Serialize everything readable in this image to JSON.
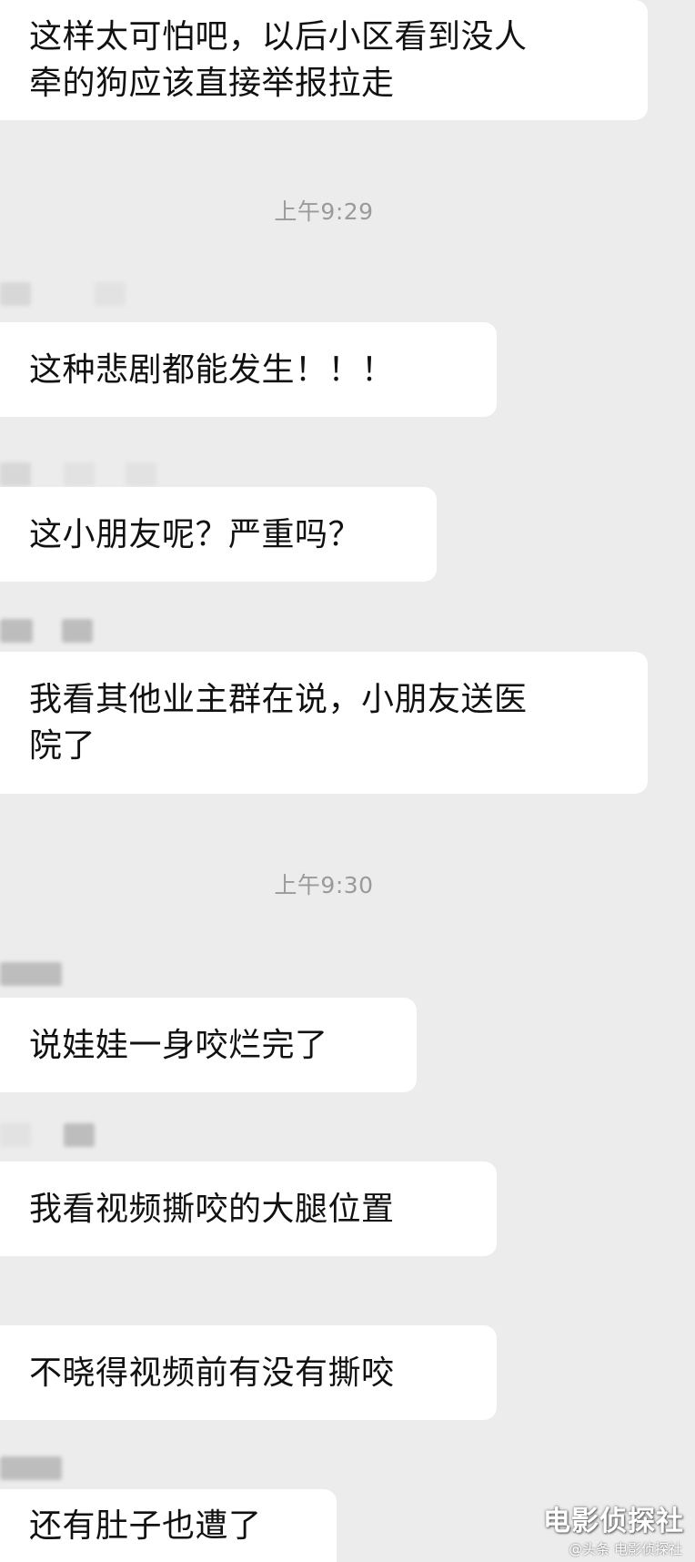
{
  "messages": [
    {
      "text": "这样太可怕吧，以后小区看到没人\n牵的狗应该直接举报拉走"
    },
    {
      "text": "这种悲剧都能发生！！！"
    },
    {
      "text": "这小朋友呢？严重吗？"
    },
    {
      "text": "我看其他业主群在说，小朋友送医\n院了"
    },
    {
      "text": "说娃娃一身咬烂完了"
    },
    {
      "text": "我看视频撕咬的大腿位置"
    },
    {
      "text": "不晓得视频前有没有撕咬"
    },
    {
      "text": "还有肚子也遭了"
    }
  ],
  "timestamps": [
    "上午9:29",
    "上午9:30"
  ],
  "watermark": {
    "main": "电影侦探社",
    "sub": "@头条 电影侦探社"
  }
}
